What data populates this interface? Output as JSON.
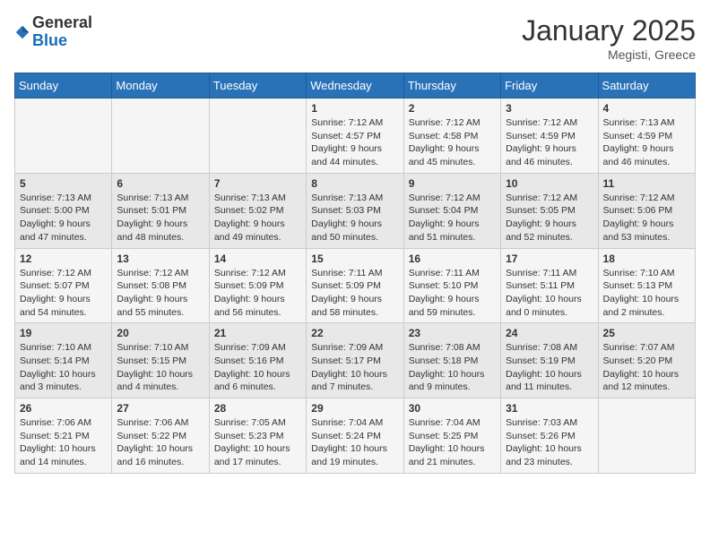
{
  "logo": {
    "general": "General",
    "blue": "Blue"
  },
  "title": "January 2025",
  "location": "Megisti, Greece",
  "days_of_week": [
    "Sunday",
    "Monday",
    "Tuesday",
    "Wednesday",
    "Thursday",
    "Friday",
    "Saturday"
  ],
  "weeks": [
    [
      {
        "day": "",
        "info": ""
      },
      {
        "day": "",
        "info": ""
      },
      {
        "day": "",
        "info": ""
      },
      {
        "day": "1",
        "info": "Sunrise: 7:12 AM\nSunset: 4:57 PM\nDaylight: 9 hours\nand 44 minutes."
      },
      {
        "day": "2",
        "info": "Sunrise: 7:12 AM\nSunset: 4:58 PM\nDaylight: 9 hours\nand 45 minutes."
      },
      {
        "day": "3",
        "info": "Sunrise: 7:12 AM\nSunset: 4:59 PM\nDaylight: 9 hours\nand 46 minutes."
      },
      {
        "day": "4",
        "info": "Sunrise: 7:13 AM\nSunset: 4:59 PM\nDaylight: 9 hours\nand 46 minutes."
      }
    ],
    [
      {
        "day": "5",
        "info": "Sunrise: 7:13 AM\nSunset: 5:00 PM\nDaylight: 9 hours\nand 47 minutes."
      },
      {
        "day": "6",
        "info": "Sunrise: 7:13 AM\nSunset: 5:01 PM\nDaylight: 9 hours\nand 48 minutes."
      },
      {
        "day": "7",
        "info": "Sunrise: 7:13 AM\nSunset: 5:02 PM\nDaylight: 9 hours\nand 49 minutes."
      },
      {
        "day": "8",
        "info": "Sunrise: 7:13 AM\nSunset: 5:03 PM\nDaylight: 9 hours\nand 50 minutes."
      },
      {
        "day": "9",
        "info": "Sunrise: 7:12 AM\nSunset: 5:04 PM\nDaylight: 9 hours\nand 51 minutes."
      },
      {
        "day": "10",
        "info": "Sunrise: 7:12 AM\nSunset: 5:05 PM\nDaylight: 9 hours\nand 52 minutes."
      },
      {
        "day": "11",
        "info": "Sunrise: 7:12 AM\nSunset: 5:06 PM\nDaylight: 9 hours\nand 53 minutes."
      }
    ],
    [
      {
        "day": "12",
        "info": "Sunrise: 7:12 AM\nSunset: 5:07 PM\nDaylight: 9 hours\nand 54 minutes."
      },
      {
        "day": "13",
        "info": "Sunrise: 7:12 AM\nSunset: 5:08 PM\nDaylight: 9 hours\nand 55 minutes."
      },
      {
        "day": "14",
        "info": "Sunrise: 7:12 AM\nSunset: 5:09 PM\nDaylight: 9 hours\nand 56 minutes."
      },
      {
        "day": "15",
        "info": "Sunrise: 7:11 AM\nSunset: 5:09 PM\nDaylight: 9 hours\nand 58 minutes."
      },
      {
        "day": "16",
        "info": "Sunrise: 7:11 AM\nSunset: 5:10 PM\nDaylight: 9 hours\nand 59 minutes."
      },
      {
        "day": "17",
        "info": "Sunrise: 7:11 AM\nSunset: 5:11 PM\nDaylight: 10 hours\nand 0 minutes."
      },
      {
        "day": "18",
        "info": "Sunrise: 7:10 AM\nSunset: 5:13 PM\nDaylight: 10 hours\nand 2 minutes."
      }
    ],
    [
      {
        "day": "19",
        "info": "Sunrise: 7:10 AM\nSunset: 5:14 PM\nDaylight: 10 hours\nand 3 minutes."
      },
      {
        "day": "20",
        "info": "Sunrise: 7:10 AM\nSunset: 5:15 PM\nDaylight: 10 hours\nand 4 minutes."
      },
      {
        "day": "21",
        "info": "Sunrise: 7:09 AM\nSunset: 5:16 PM\nDaylight: 10 hours\nand 6 minutes."
      },
      {
        "day": "22",
        "info": "Sunrise: 7:09 AM\nSunset: 5:17 PM\nDaylight: 10 hours\nand 7 minutes."
      },
      {
        "day": "23",
        "info": "Sunrise: 7:08 AM\nSunset: 5:18 PM\nDaylight: 10 hours\nand 9 minutes."
      },
      {
        "day": "24",
        "info": "Sunrise: 7:08 AM\nSunset: 5:19 PM\nDaylight: 10 hours\nand 11 minutes."
      },
      {
        "day": "25",
        "info": "Sunrise: 7:07 AM\nSunset: 5:20 PM\nDaylight: 10 hours\nand 12 minutes."
      }
    ],
    [
      {
        "day": "26",
        "info": "Sunrise: 7:06 AM\nSunset: 5:21 PM\nDaylight: 10 hours\nand 14 minutes."
      },
      {
        "day": "27",
        "info": "Sunrise: 7:06 AM\nSunset: 5:22 PM\nDaylight: 10 hours\nand 16 minutes."
      },
      {
        "day": "28",
        "info": "Sunrise: 7:05 AM\nSunset: 5:23 PM\nDaylight: 10 hours\nand 17 minutes."
      },
      {
        "day": "29",
        "info": "Sunrise: 7:04 AM\nSunset: 5:24 PM\nDaylight: 10 hours\nand 19 minutes."
      },
      {
        "day": "30",
        "info": "Sunrise: 7:04 AM\nSunset: 5:25 PM\nDaylight: 10 hours\nand 21 minutes."
      },
      {
        "day": "31",
        "info": "Sunrise: 7:03 AM\nSunset: 5:26 PM\nDaylight: 10 hours\nand 23 minutes."
      },
      {
        "day": "",
        "info": ""
      }
    ]
  ]
}
